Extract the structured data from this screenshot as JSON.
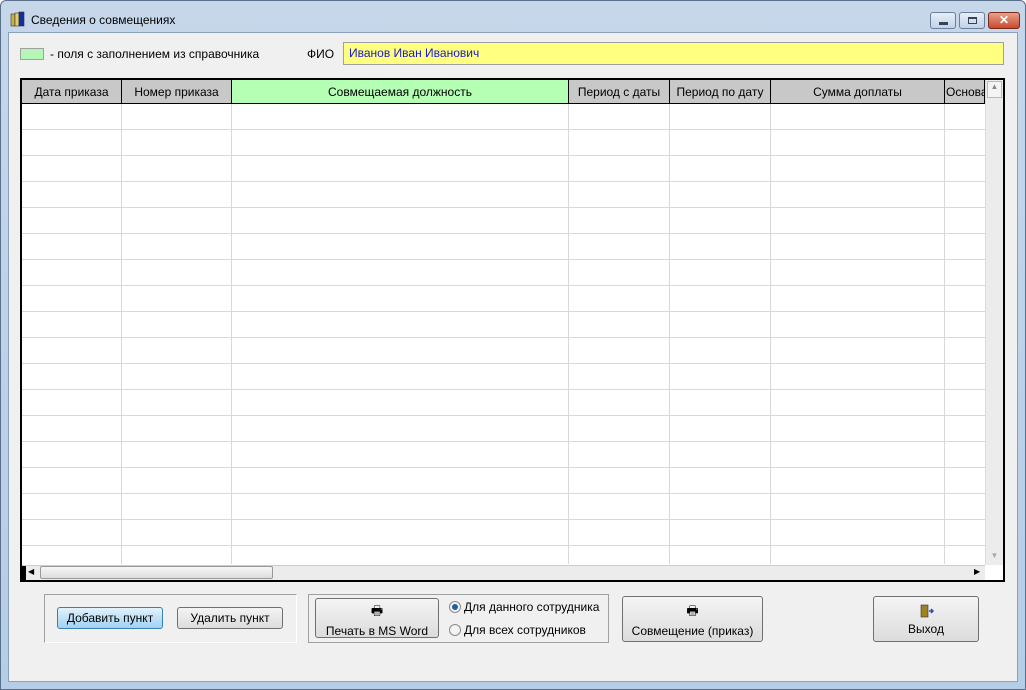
{
  "window": {
    "title": "Сведения о совмещениях",
    "icon": "books-icon"
  },
  "legend": {
    "text": "- поля с заполнением из справочника",
    "swatch_color": "#b5f5b5"
  },
  "fio": {
    "label": "ФИО",
    "value": "Иванов Иван Иванович"
  },
  "table": {
    "columns": [
      {
        "label": "Дата приказа",
        "lookup": false
      },
      {
        "label": "Номер приказа",
        "lookup": false
      },
      {
        "label": "Совмещаемая должность",
        "lookup": true
      },
      {
        "label": "Период с даты",
        "lookup": false
      },
      {
        "label": "Период по дату",
        "lookup": false
      },
      {
        "label": "Сумма доплаты",
        "lookup": false
      },
      {
        "label": "Основа",
        "lookup": false
      }
    ],
    "rows": []
  },
  "buttons": {
    "add": "Добавить пункт",
    "delete": "Удалить пункт",
    "print_word": "Печать в MS Word",
    "combination_order": "Совмещение (приказ)",
    "exit": "Выход"
  },
  "print_scope": {
    "options": [
      "Для данного сотрудника",
      "Для всех сотрудников"
    ],
    "selected": 0
  }
}
